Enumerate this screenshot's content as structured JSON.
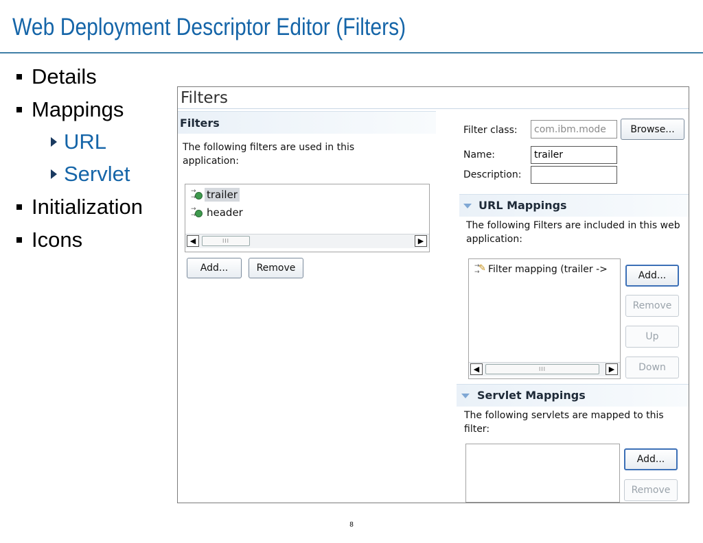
{
  "slide": {
    "title": "Web Deployment Descriptor Editor (Filters)",
    "bullets": [
      {
        "label": "Details"
      },
      {
        "label": "Mappings"
      },
      {
        "label": "URL"
      },
      {
        "label": "Servlet"
      },
      {
        "label": "Initialization"
      },
      {
        "label": "Icons"
      }
    ],
    "page_number": "8"
  },
  "editor": {
    "title": "Filters",
    "filters_section": {
      "title": "Filters",
      "description": "The following filters are used in this application:",
      "items": [
        {
          "label": "trailer",
          "selected": true
        },
        {
          "label": "header",
          "selected": false
        }
      ],
      "scroll_thumb": "III",
      "add_label": "Add...",
      "remove_label": "Remove"
    },
    "details": {
      "filter_class_label": "Filter class:",
      "filter_class_value": "com.ibm.mode",
      "browse_label": "Browse...",
      "name_label": "Name:",
      "name_value": "trailer",
      "description_label": "Description:",
      "description_value": ""
    },
    "url_mappings": {
      "title": "URL Mappings",
      "description": "The following Filters are included in this web application:",
      "items": [
        {
          "label": "Filter mapping (trailer ->"
        }
      ],
      "scroll_thumb": "III",
      "add_label": "Add...",
      "remove_label": "Remove",
      "up_label": "Up",
      "down_label": "Down"
    },
    "servlet_mappings": {
      "title": "Servlet Mappings",
      "description": "The following servlets are mapped to this filter:",
      "add_label": "Add...",
      "remove_label": "Remove"
    }
  },
  "colors": {
    "title_blue": "#1565a8",
    "section_header": "#eaf1f8"
  }
}
